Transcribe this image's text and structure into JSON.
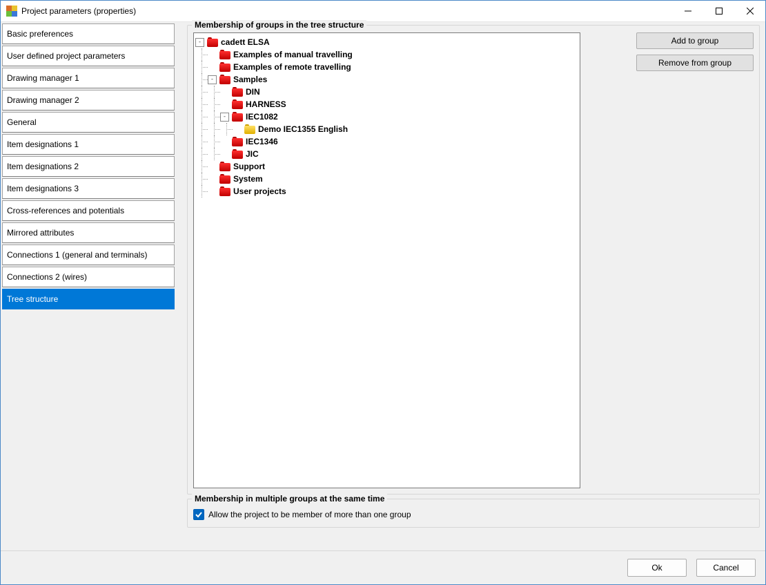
{
  "window_title": "Project parameters (properties)",
  "app_icon_colors": [
    "#d96d2a",
    "#e9c32f",
    "#6bbf3b",
    "#3a78d8"
  ],
  "sidebar": {
    "items": [
      "Basic preferences",
      "User defined project parameters",
      "Drawing manager 1",
      "Drawing manager 2",
      "General",
      "Item designations 1",
      "Item designations 2",
      "Item designations 3",
      "Cross-references and potentials",
      "Mirrored attributes",
      "Connections 1 (general and terminals)",
      "Connections 2 (wires)",
      "Tree structure"
    ],
    "selected_index": 12
  },
  "groups": {
    "tree_title": "Membership of groups in the tree structure",
    "multi_title": "Membership in multiple groups at the same time"
  },
  "tree": [
    {
      "depth": 0,
      "expander": "-",
      "color": "red",
      "label": "cadett ELSA"
    },
    {
      "depth": 1,
      "expander": "",
      "color": "red",
      "label": "Examples of manual travelling"
    },
    {
      "depth": 1,
      "expander": "",
      "color": "red",
      "label": "Examples of remote travelling"
    },
    {
      "depth": 1,
      "expander": "-",
      "color": "red",
      "label": "Samples"
    },
    {
      "depth": 2,
      "expander": "",
      "color": "red",
      "label": "DIN"
    },
    {
      "depth": 2,
      "expander": "",
      "color": "red",
      "label": "HARNESS"
    },
    {
      "depth": 2,
      "expander": "-",
      "color": "red",
      "label": "IEC1082"
    },
    {
      "depth": 3,
      "expander": "",
      "color": "yellow",
      "label": "Demo IEC1355 English"
    },
    {
      "depth": 2,
      "expander": "",
      "color": "red",
      "label": "IEC1346"
    },
    {
      "depth": 2,
      "expander": "",
      "color": "red",
      "label": "JIC"
    },
    {
      "depth": 1,
      "expander": "",
      "color": "red",
      "label": "Support"
    },
    {
      "depth": 1,
      "expander": "",
      "color": "red",
      "label": "System"
    },
    {
      "depth": 1,
      "expander": "",
      "color": "red",
      "label": "User projects"
    }
  ],
  "buttons": {
    "add": "Add to group",
    "remove": "Remove from group",
    "ok": "Ok",
    "cancel": "Cancel"
  },
  "checkbox": {
    "allow_multi": "Allow the project to be member of more than one group",
    "checked": true
  }
}
